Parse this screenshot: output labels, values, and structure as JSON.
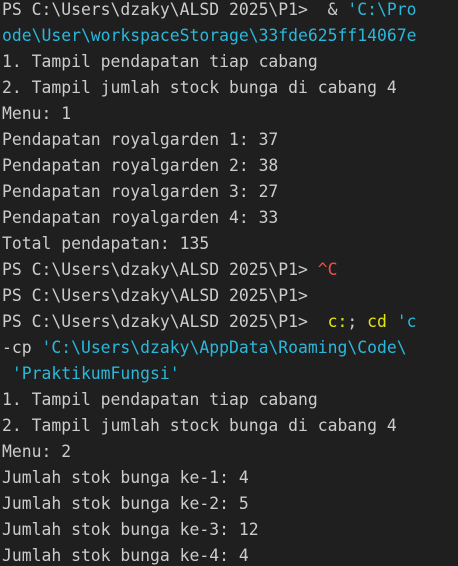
{
  "terminal": {
    "lines": [
      {
        "segments": [
          {
            "text": "PS C:\\Users\\dzaky\\ALSD 2025\\P1>  & ",
            "color": "default"
          },
          {
            "text": "'C:\\Pro",
            "color": "cyan"
          }
        ]
      },
      {
        "segments": [
          {
            "text": "ode\\User\\workspaceStorage\\33fde625ff14067e",
            "color": "cyan"
          }
        ]
      },
      {
        "segments": [
          {
            "text": "1. Tampil pendapatan tiap cabang",
            "color": "default"
          }
        ]
      },
      {
        "segments": [
          {
            "text": "2. Tampil jumlah stock bunga di cabang 4",
            "color": "default"
          }
        ]
      },
      {
        "segments": [
          {
            "text": "Menu: 1",
            "color": "default"
          }
        ]
      },
      {
        "segments": [
          {
            "text": "Pendapatan royalgarden 1: 37",
            "color": "default"
          }
        ]
      },
      {
        "segments": [
          {
            "text": "Pendapatan royalgarden 2: 38",
            "color": "default"
          }
        ]
      },
      {
        "segments": [
          {
            "text": "Pendapatan royalgarden 3: 27",
            "color": "default"
          }
        ]
      },
      {
        "segments": [
          {
            "text": "Pendapatan royalgarden 4: 33",
            "color": "default"
          }
        ]
      },
      {
        "segments": [
          {
            "text": "Total pendapatan: 135",
            "color": "default"
          }
        ]
      },
      {
        "segments": [
          {
            "text": "PS C:\\Users\\dzaky\\ALSD 2025\\P1> ",
            "color": "default"
          },
          {
            "text": "^C",
            "color": "red"
          }
        ]
      },
      {
        "segments": [
          {
            "text": "PS C:\\Users\\dzaky\\ALSD 2025\\P1>",
            "color": "default"
          }
        ]
      },
      {
        "segments": [
          {
            "text": "PS C:\\Users\\dzaky\\ALSD 2025\\P1>  ",
            "color": "default"
          },
          {
            "text": "c:",
            "color": "yellow"
          },
          {
            "text": "; ",
            "color": "default"
          },
          {
            "text": "cd",
            "color": "yellow"
          },
          {
            "text": " 'c",
            "color": "cyan"
          }
        ]
      },
      {
        "segments": [
          {
            "text": "-cp",
            "color": "default"
          },
          {
            "text": " 'C:\\Users\\dzaky\\AppData\\Roaming\\Code\\",
            "color": "cyan"
          }
        ]
      },
      {
        "segments": [
          {
            "text": " 'PraktikumFungsi'",
            "color": "cyan"
          }
        ]
      },
      {
        "segments": [
          {
            "text": "1. Tampil pendapatan tiap cabang",
            "color": "default"
          }
        ]
      },
      {
        "segments": [
          {
            "text": "2. Tampil jumlah stock bunga di cabang 4",
            "color": "default"
          }
        ]
      },
      {
        "segments": [
          {
            "text": "Menu: 2",
            "color": "default"
          }
        ]
      },
      {
        "segments": [
          {
            "text": "Jumlah stok bunga ke-1: 4",
            "color": "default"
          }
        ]
      },
      {
        "segments": [
          {
            "text": "Jumlah stok bunga ke-2: 5",
            "color": "default"
          }
        ]
      },
      {
        "segments": [
          {
            "text": "Jumlah stok bunga ke-3: 12",
            "color": "default"
          }
        ]
      },
      {
        "segments": [
          {
            "text": "Jumlah stok bunga ke-4: 4",
            "color": "default"
          }
        ]
      }
    ]
  },
  "colors": {
    "background": "#1f1f1f",
    "default": "#cccccc",
    "cyan": "#29b8db",
    "yellow": "#e5e510",
    "red": "#f14c4c"
  }
}
